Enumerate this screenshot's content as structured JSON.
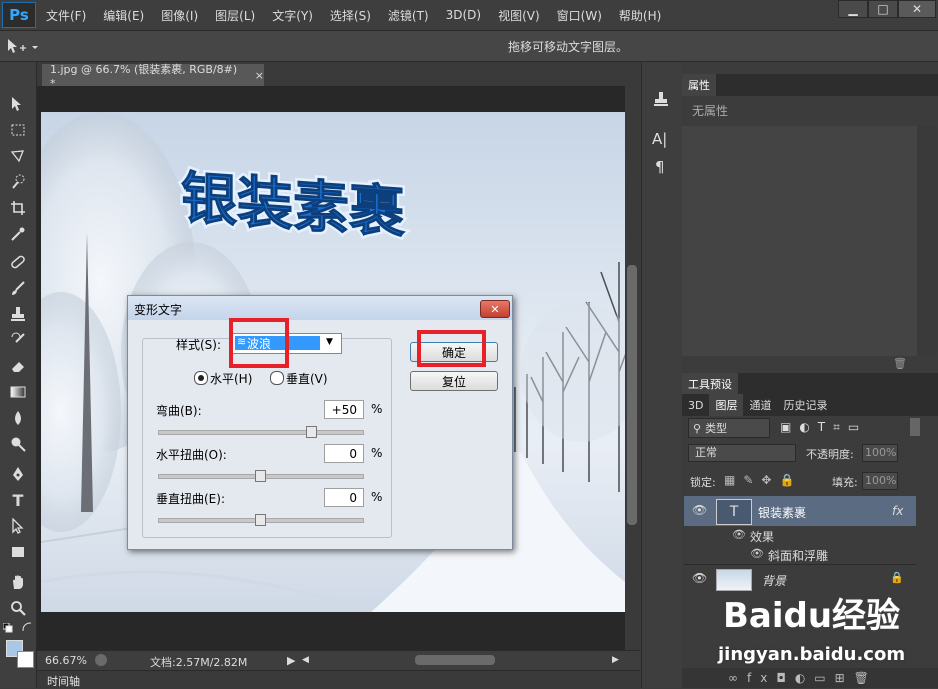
{
  "app": {
    "logo": "Ps"
  },
  "menu": [
    "文件(F)",
    "编辑(E)",
    "图像(I)",
    "图层(L)",
    "文字(Y)",
    "选择(S)",
    "滤镜(T)",
    "3D(D)",
    "视图(V)",
    "窗口(W)",
    "帮助(H)"
  ],
  "window_controls": {
    "minimize": "▁",
    "maximize": "□",
    "close": "✕"
  },
  "options_bar": {
    "hint": "拖移可移动文字图层。"
  },
  "document": {
    "tab_title": "1.jpg @ 66.7% (银装素裹, RGB/8#) *",
    "tab_close": "×",
    "text_layer_content": "银装素裹"
  },
  "status": {
    "zoom": "66.67%",
    "doc_info": "文档:2.57M/2.82M"
  },
  "timeline": {
    "label": "时间轴"
  },
  "properties_panel": {
    "title": "属性",
    "empty": "无属性"
  },
  "tool_presets_panel": {
    "title": "工具预设"
  },
  "layers_panel": {
    "tabs": [
      "3D",
      "图层",
      "通道",
      "历史记录"
    ],
    "active_tab": "图层",
    "filter_label": "类型",
    "blend_mode": "正常",
    "opacity_label": "不透明度:",
    "opacity_value": "100%",
    "lock_label": "锁定:",
    "fill_label": "填充:",
    "fill_value": "100%",
    "layers": [
      {
        "name": "银装素裹",
        "thumb": "T",
        "fx": "fx"
      },
      {
        "name": "效果",
        "type": "effects-group"
      },
      {
        "name": "斜面和浮雕",
        "type": "effect"
      },
      {
        "name": "背景",
        "type": "background"
      }
    ]
  },
  "warp_dialog": {
    "title": "变形文字",
    "style_label": "样式(S):",
    "style_value": "波浪",
    "ok_label": "确定",
    "reset_label": "复位",
    "horizontal_label": "水平(H)",
    "vertical_label": "垂直(V)",
    "orientation_selected": "水平(H)",
    "bend_label": "弯曲(B):",
    "bend_value": "+50",
    "hdist_label": "水平扭曲(O):",
    "hdist_value": "0",
    "vdist_label": "垂直扭曲(E):",
    "vdist_value": "0",
    "percent": "%",
    "bend_level": 50,
    "hdist_level": 0,
    "vdist_level": 0
  },
  "watermark": {
    "brand": "Baidu经验",
    "url": "jingyan.baidu.com"
  },
  "colors": {
    "highlight": "#e8202a",
    "selection": "#3399ff",
    "text_blue": "#1a6fd0"
  }
}
